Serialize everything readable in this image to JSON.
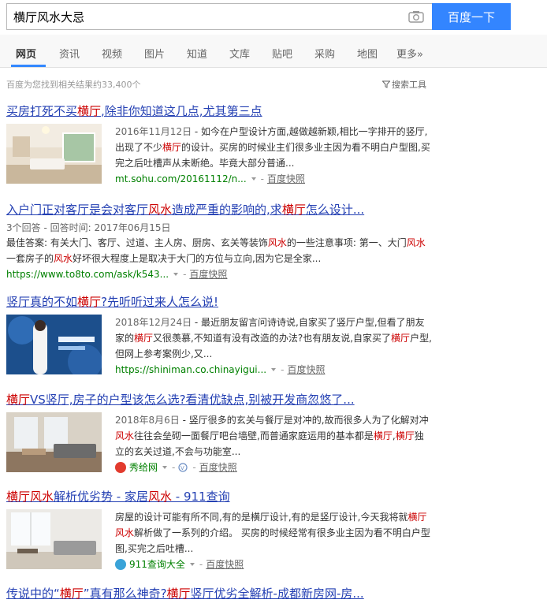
{
  "search": {
    "query": "横厅风水大忌",
    "button_label": "百度一下"
  },
  "tabs": [
    "网页",
    "资讯",
    "视频",
    "图片",
    "知道",
    "文库",
    "贴吧",
    "采购",
    "地图",
    "更多»"
  ],
  "stats": {
    "text": "百度为您找到相关结果约33,400个",
    "tools_label": "搜索工具"
  },
  "results": [
    {
      "title_parts": [
        "买房打死不买",
        "横厅",
        ",除非你知道这几点,尤其第三点"
      ],
      "date": "2016年11月12日",
      "abstract_parts": [
        " - 如今在户型设计方面,越做越新颖,相比一字排开的竖厅,出现了不少",
        "横厅",
        "的设计。买房的时候业主们很多业主因为看不明白户型图,买完之后吐槽声从未断绝。毕竟大部分普通..."
      ],
      "url": "mt.sohu.com/20161112/n...",
      "kuaizhao": "百度快照"
    },
    {
      "title_parts": [
        "入户门正对客厅是会对客厅",
        "风水",
        "造成严重的影响的,求",
        "横厅",
        "怎么设计..."
      ],
      "meta": "3个回答 - 回答时间: 2017年06月15日",
      "abstract_parts": [
        "最佳答案: 有关大门、客厅、过道、主人房、厨房、玄关等装饰",
        "风水",
        "的一些注意事项:  第一、大门",
        "风水",
        " 一套房子的",
        "风水",
        "好坏很大程度上是取决于大门的方位与立向,因为它是全家..."
      ],
      "url": "https://www.to8to.com/ask/k543...",
      "kuaizhao": "百度快照"
    },
    {
      "title_parts": [
        "竖厅真的不如",
        "横厅",
        "?先听听过来人怎么说!"
      ],
      "date": "2018年12月24日",
      "abstract_parts": [
        " - 最近朋友留言问诗诗说,自家买了竖厅户型,但看了朋友家的",
        "横厅",
        "又很羡慕,不知道有没有改造的办法?也有朋友说,自家买了",
        "横厅",
        "户型,但网上参考案例少,又..."
      ],
      "url": "https://shiniman.co.chinayigui...",
      "kuaizhao": "百度快照"
    },
    {
      "title_parts": [
        "横厅",
        "VS竖厅,房子的户型该怎么选?看清优缺点,别被开发商忽悠了..."
      ],
      "date": "2018年8月6日",
      "abstract_parts": [
        " - 竖厅很多的玄关与餐厅是对冲的,故而很多人为了化解对冲",
        "风水",
        "往往会垒砌一面餐厅吧台墙壁,而普通家庭运用的基本都是",
        "横厅",
        ",",
        "横厅",
        "独立的玄关过道,不会与功能室..."
      ],
      "site": "秀给网",
      "kuaizhao": "百度快照"
    },
    {
      "title_parts": [
        "横厅",
        "风水",
        "解析优劣势 - 家居",
        "风水",
        " - 911查询"
      ],
      "abstract_parts": [
        "房屋的设计可能有所不同,有的是横厅设计,有的是竖厅设计,今天我将就",
        "横厅",
        "风水",
        "解析做了一系列的介绍。 买房的时候经常有很多业主因为看不明白户型图,买完之后吐槽..."
      ],
      "site": "911查询大全",
      "kuaizhao": "百度快照"
    },
    {
      "title_parts": [
        "传说中的“",
        "横厅",
        "”真有那么神奇?",
        "横厅",
        "竖厅优劣全解析-成都新房网-房..."
      ]
    }
  ]
}
